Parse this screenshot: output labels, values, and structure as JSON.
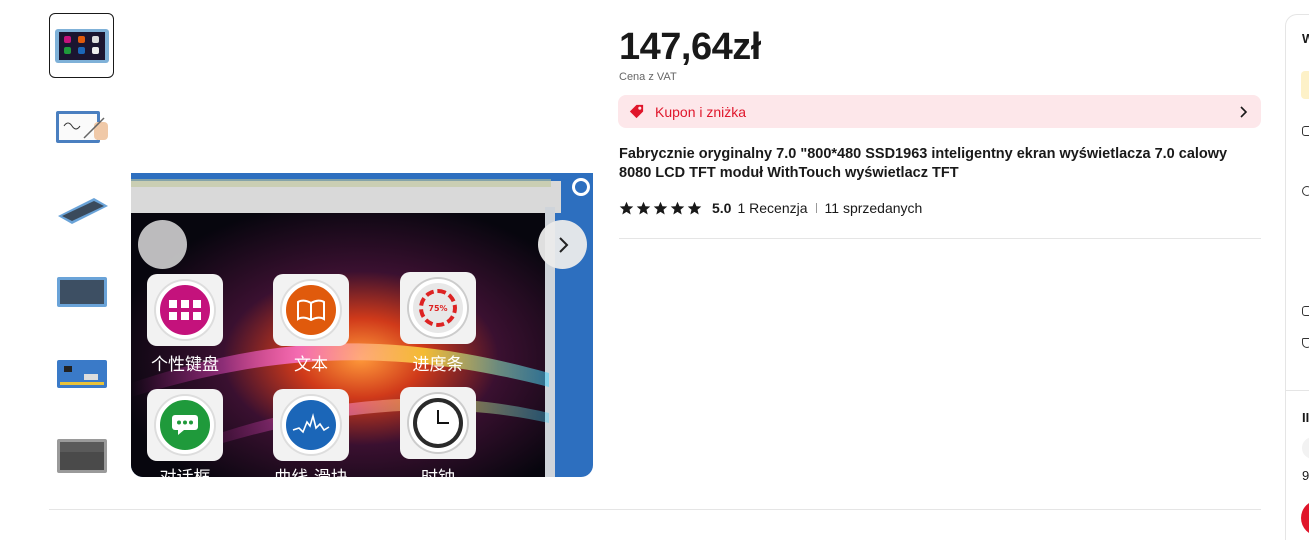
{
  "gallery": {
    "thumbnails": [
      {
        "name": "thumb-screen-icons",
        "active": true
      },
      {
        "name": "thumb-handwriting"
      },
      {
        "name": "thumb-angled-display"
      },
      {
        "name": "thumb-front-display"
      },
      {
        "name": "thumb-pcb-back"
      },
      {
        "name": "thumb-bezel"
      }
    ],
    "screen_icons": [
      {
        "label": "个性键盘",
        "color": "#c4127c"
      },
      {
        "label": "文本",
        "color": "#e05a0c"
      },
      {
        "label": "进度条",
        "color": "#d8d8d8",
        "badge": "75%"
      },
      {
        "label": "对话框",
        "color": "#1f9a3b"
      },
      {
        "label": "曲线 滑块",
        "color": "#1b66b8"
      },
      {
        "label": "时钟",
        "color": "#2a2a2a"
      }
    ]
  },
  "product": {
    "price": "147,64zł",
    "price_note": "Cena z VAT",
    "coupon_label": "Kupon i zniżka",
    "title": "Fabrycznie oryginalny 7.0 \"800*480 SSD1963 inteligentny ekran wyświetlacza 7.0 calowy 8080 LCD TFT moduł WithTouch wyświetlacz TFT",
    "rating_score": "5.0",
    "rating_stars": 5,
    "reviews": "1 Recenzja",
    "sold": "11 sprzedanych"
  },
  "right_panel": {
    "heading_initial": "W",
    "section_initial": "II",
    "number_initial": "9"
  },
  "colors": {
    "accent": "#e0162b",
    "coupon_bg": "#fde7ea"
  }
}
